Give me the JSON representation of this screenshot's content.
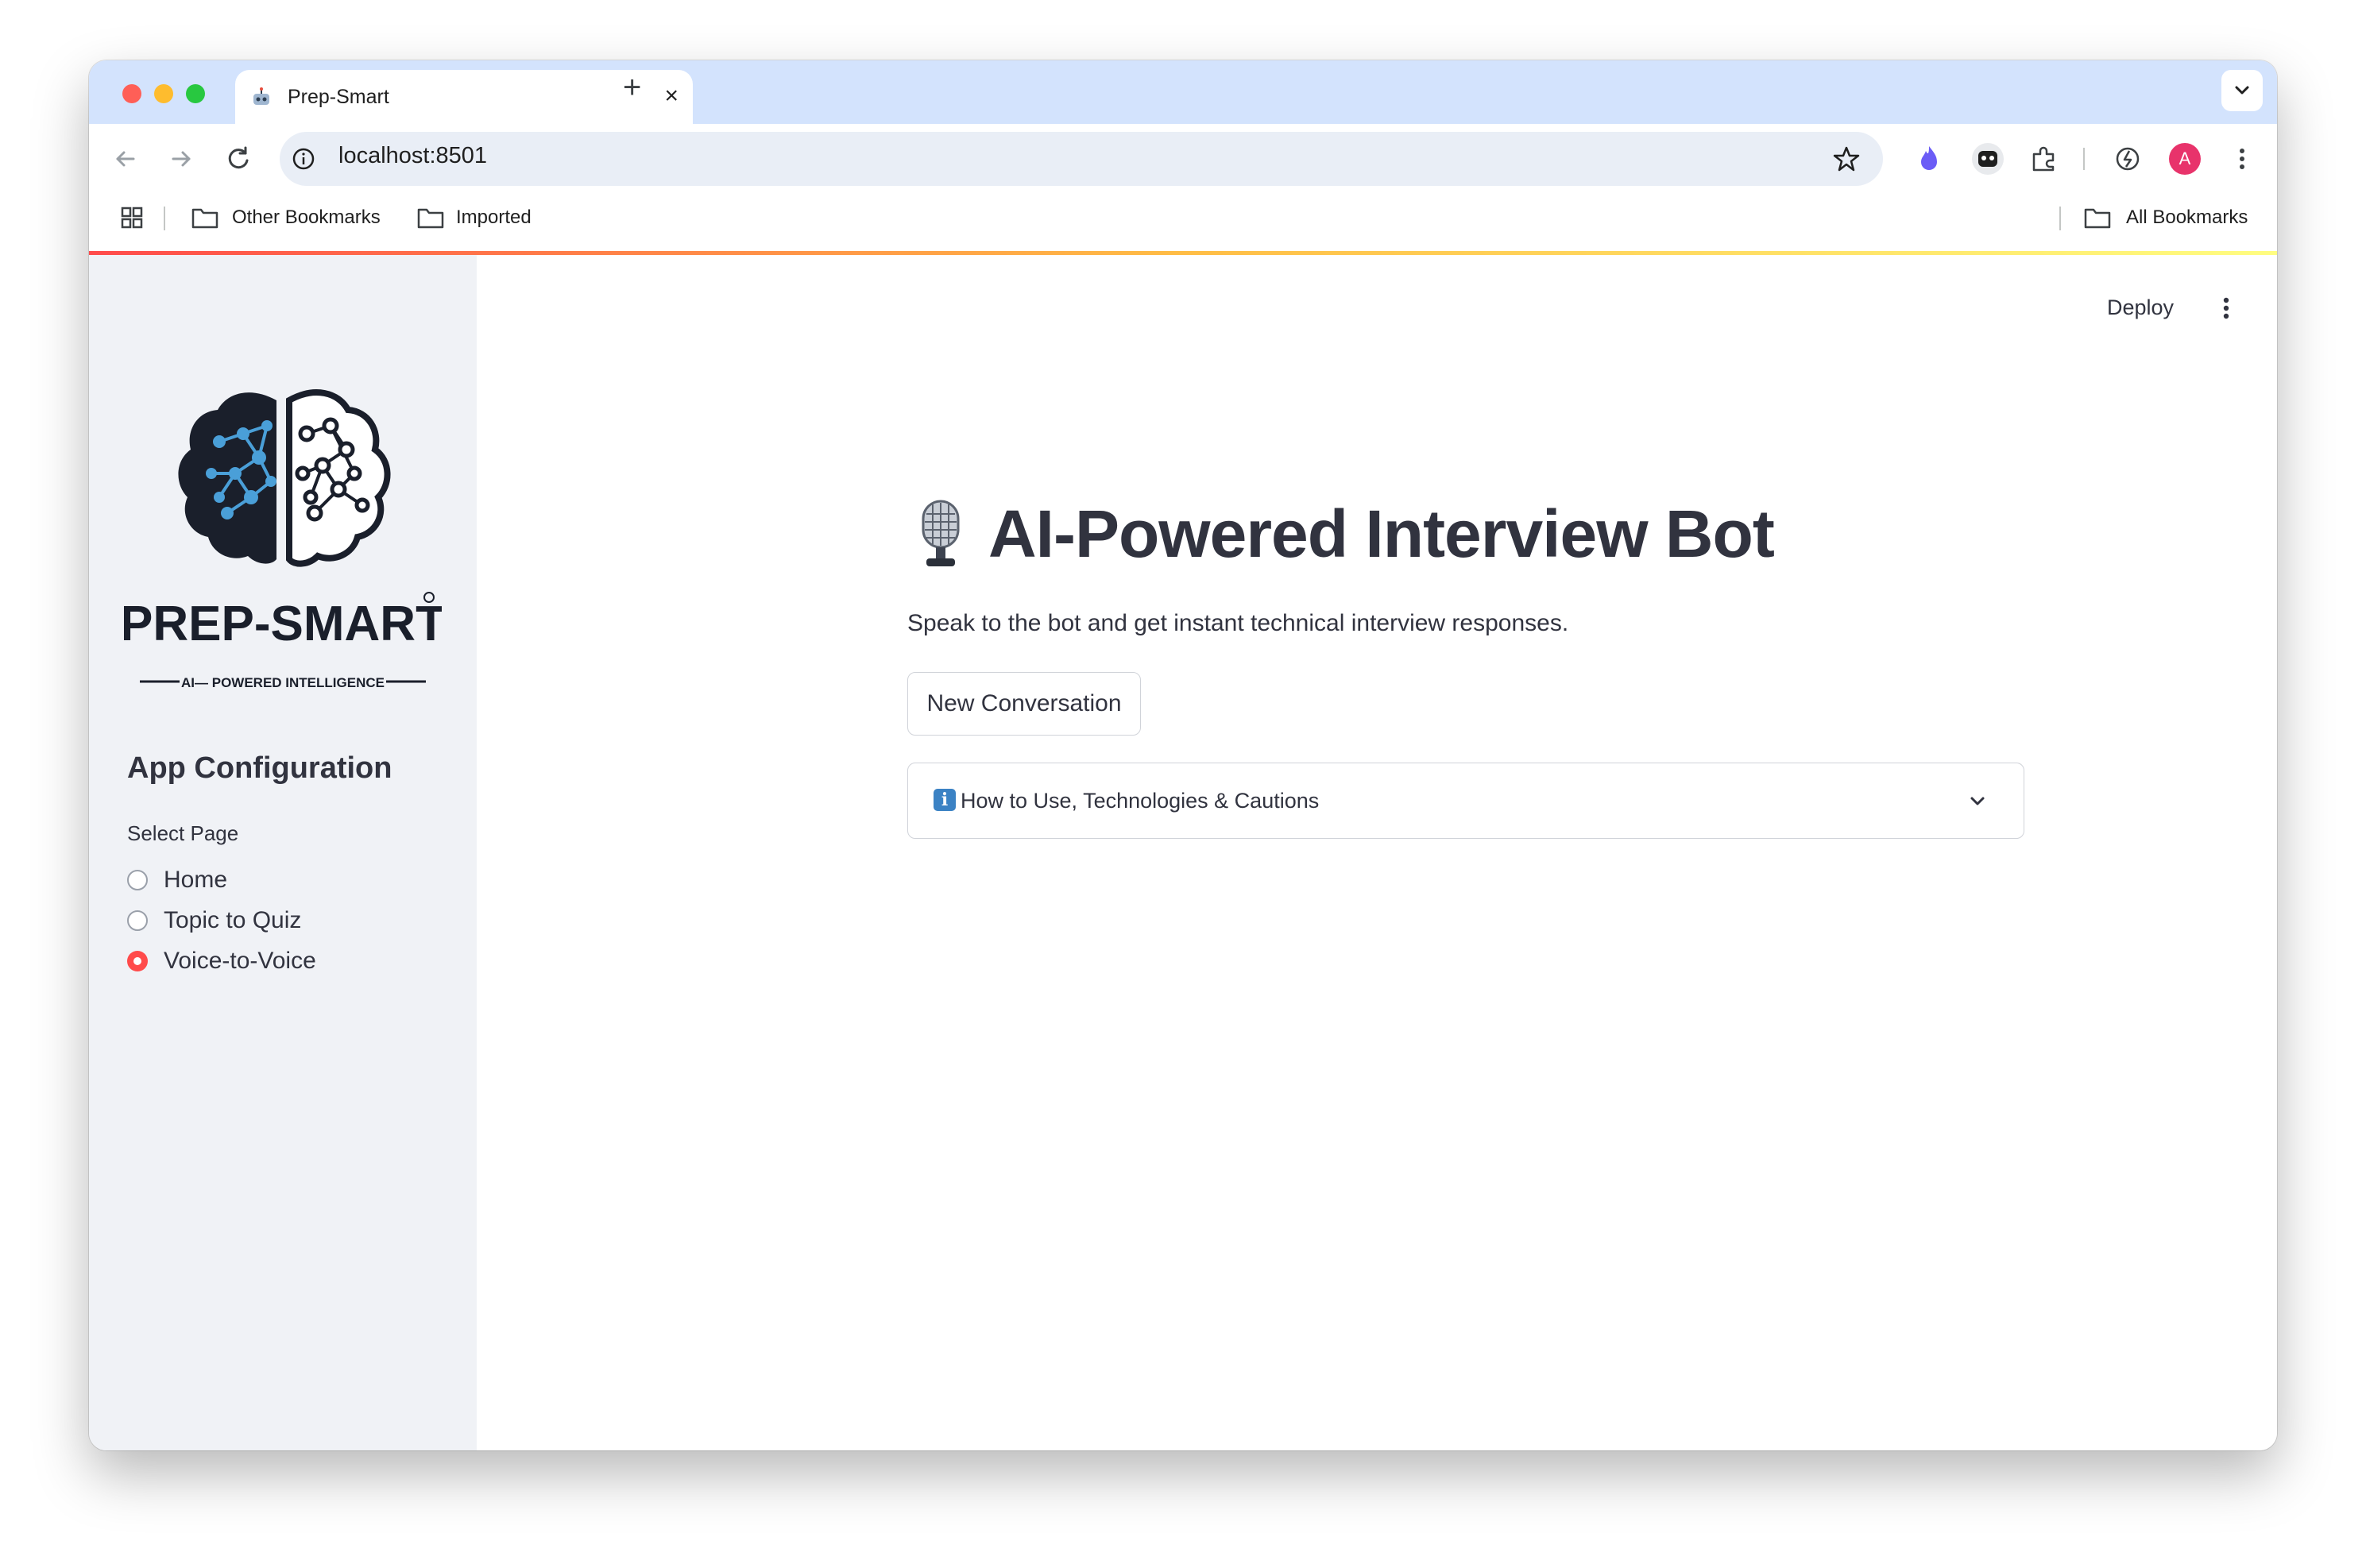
{
  "browser": {
    "tab_title": "Prep-Smart",
    "new_tab": "+",
    "close_tab": "×",
    "url": "localhost:8501",
    "profile_initial": "A",
    "bookmarks": {
      "other": "Other Bookmarks",
      "imported": "Imported",
      "all": "All Bookmarks"
    }
  },
  "header": {
    "deploy_label": "Deploy"
  },
  "sidebar": {
    "logo_text": "PREP-SMART",
    "logo_tagline": "AI— POWERED INTELLIGENCE",
    "heading": "App Configuration",
    "select_label": "Select Page",
    "pages": [
      {
        "label": "Home",
        "selected": false
      },
      {
        "label": "Topic to Quiz",
        "selected": false
      },
      {
        "label": "Voice-to-Voice",
        "selected": true
      }
    ]
  },
  "main": {
    "title": "AI-Powered Interview Bot",
    "subtitle": "Speak to the bot and get instant technical interview responses.",
    "new_conversation_label": "New Conversation",
    "expander_label": "How to Use, Technologies & Cautions",
    "expander_icon": "info-icon"
  },
  "colors": {
    "accent": "#ff4b4b",
    "sidebar_bg": "#f0f2f6",
    "tab_strip": "#d3e3fd",
    "text": "#31333f",
    "logo_blue": "#4a9fd8"
  }
}
